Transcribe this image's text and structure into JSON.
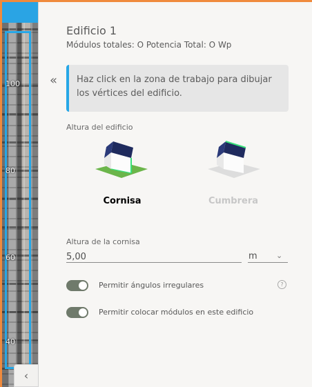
{
  "map": {
    "labels": [
      "100",
      "80",
      "60",
      "40"
    ],
    "collapse_icon": "chevron-left-icon"
  },
  "panel": {
    "title": "Edificio 1",
    "subtitle": "Módulos totales: O Potencia Total: O Wp",
    "info_text": "Haz click en la zona de trabajo para dibujar los vértices del edificio.",
    "building_height_label": "Altura del edificio",
    "options": [
      {
        "label": "Cornisa",
        "selected": true,
        "color": "#2e2e2e"
      },
      {
        "label": "Cumbrera",
        "selected": false,
        "color": "#c7c7c7"
      }
    ],
    "cornice_height_label": "Altura de la cornisa",
    "cornice_height_value": "5,00",
    "unit": "m",
    "toggles": [
      {
        "label": "Permitir ángulos irregulares",
        "on": true,
        "help": "?"
      },
      {
        "label": "Permitir colocar módulos en este edificio",
        "on": true
      }
    ]
  },
  "colors": {
    "accent": "#27a7e6",
    "frame": "#f08a3c",
    "toggle": "#6f7a6b",
    "green": "#34d26a"
  }
}
